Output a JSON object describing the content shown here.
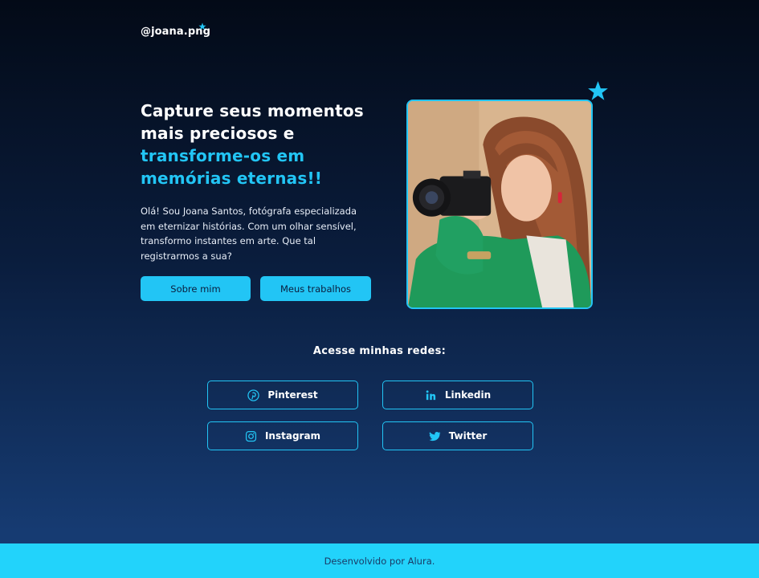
{
  "header": {
    "logo_text": "@joana.png"
  },
  "hero": {
    "title_line1": "Capture seus momentos",
    "title_line2": "mais preciosos e",
    "title_accent_line1": "transforme-os em",
    "title_accent_line2": "memórias eternas!!",
    "description": "Olá! Sou Joana Santos, fotógrafa especializada em eternizar histórias. Com um olhar sensível, transformo instantes em arte. Que tal registrarmos a sua?",
    "buttons": {
      "about": "Sobre mim",
      "works": "Meus trabalhos"
    }
  },
  "social": {
    "title": "Acesse minhas redes:",
    "links": [
      {
        "label": "Pinterest",
        "icon": "pinterest-icon"
      },
      {
        "label": "Linkedin",
        "icon": "linkedin-icon"
      },
      {
        "label": "Instagram",
        "icon": "instagram-icon"
      },
      {
        "label": "Twitter",
        "icon": "twitter-icon"
      }
    ]
  },
  "footer": {
    "text": "Desenvolvido por Alura."
  },
  "colors": {
    "accent": "#22c5f5",
    "footer_bg": "#22d3fb",
    "bg_top": "#030a17",
    "bg_bottom": "#163b72"
  }
}
